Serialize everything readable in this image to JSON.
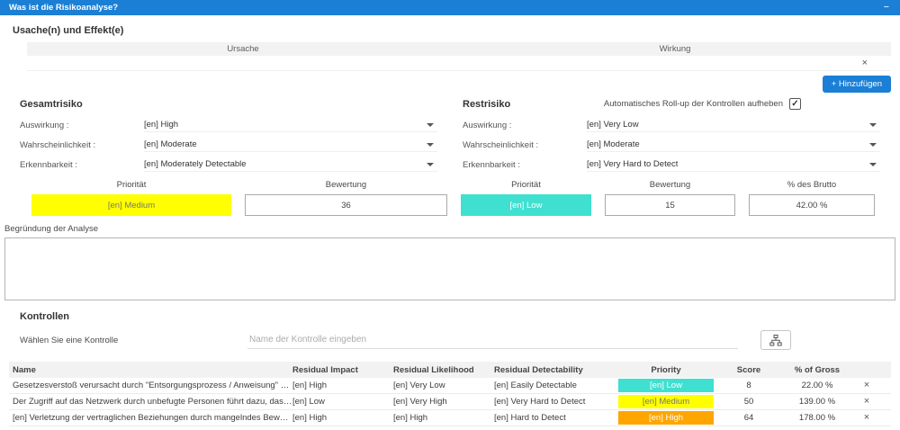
{
  "colors": {
    "accent": "#1b7fd5",
    "priority_low": "#40e0d0",
    "priority_medium": "#ffff00",
    "priority_high": "#ffa500"
  },
  "icons": {
    "dropdown": "chevron-down-icon",
    "control_picker": "hierarchy-icon",
    "remove": "close-icon"
  },
  "header": {
    "title": "Was ist die Risikoanalyse?",
    "minimize": "−"
  },
  "cause_effect": {
    "title": "Usache(n) und Effekt(e)",
    "columns": [
      "Ursache",
      "Wirkung"
    ],
    "remove_label": "×",
    "add_button_label": "+ Hinzufügen"
  },
  "gross_risk": {
    "title": "Gesamtrisiko",
    "fields": [
      {
        "label": "Auswirkung :",
        "value": "[en] High"
      },
      {
        "label": "Wahrscheinlichkeit :",
        "value": "[en] Moderate"
      },
      {
        "label": "Erkennbarkeit :",
        "value": "[en] Moderately Detectable"
      }
    ],
    "priority": {
      "label": "Priorität",
      "value": "[en] Medium",
      "bg": "#ffff00",
      "fg": "#757575"
    },
    "score": {
      "label": "Bewertung",
      "value": "36"
    }
  },
  "residual_risk": {
    "title": "Restrisiko",
    "rollup_label": "Automatisches Roll-up der Kontrollen aufheben",
    "rollup_checked": true,
    "fields": [
      {
        "label": "Auswirkung :",
        "value": "[en] Very Low"
      },
      {
        "label": "Wahrscheinlichkeit :",
        "value": "[en] Moderate"
      },
      {
        "label": "Erkennbarkeit :",
        "value": "[en] Very Hard to Detect"
      }
    ],
    "priority": {
      "label": "Priorität",
      "value": "[en] Low",
      "bg": "#40e0d0",
      "fg": "#ffffff"
    },
    "score": {
      "label": "Bewertung",
      "value": "15"
    },
    "percent": {
      "label": "% des Brutto",
      "value": "42.00 %"
    }
  },
  "analysis": {
    "label": "Begründung der Analyse",
    "value": ""
  },
  "controls": {
    "title": "Kontrollen",
    "picker_label": "Wählen Sie eine Kontrolle",
    "input_placeholder": "Name der Kontrolle eingeben",
    "table": {
      "headers": [
        "Name",
        "Residual Impact",
        "Residual Likelihood",
        "Residual Detectability",
        "Priority",
        "Score",
        "% of Gross"
      ],
      "rows": [
        {
          "name": "Gesetzesverstoß verursacht durch \"Entsorgungsprozess / Anweisung\" Ungehorsam",
          "impact": "[en] High",
          "likelihood": "[en] Very Low",
          "detectability": "[en] Easily Detectable",
          "priority": "[en] Low",
          "priority_bg": "#40e0d0",
          "priority_fg": "#ffffff",
          "score": "8",
          "percent": "22.00 %",
          "remove_label": "×"
        },
        {
          "name": "Der Zugriff auf das Netzwerk durch unbefugte Personen führt dazu, dass von Clients sch...",
          "impact": "[en] Low",
          "likelihood": "[en] Very High",
          "detectability": "[en] Very Hard to Detect",
          "priority": "[en] Medium",
          "priority_bg": "#ffff00",
          "priority_fg": "#757575",
          "score": "50",
          "percent": "139.00 %",
          "remove_label": "×"
        },
        {
          "name": "[en] Verletzung der vertraglichen Beziehungen durch mangelndes Bewusstsein der Kund...",
          "impact": "[en] High",
          "likelihood": "[en] High",
          "detectability": "[en] Hard to Detect",
          "priority": "[en] High",
          "priority_bg": "#ffa500",
          "priority_fg": "#ffffff",
          "score": "64",
          "percent": "178.00 %",
          "remove_label": "×"
        }
      ]
    }
  }
}
